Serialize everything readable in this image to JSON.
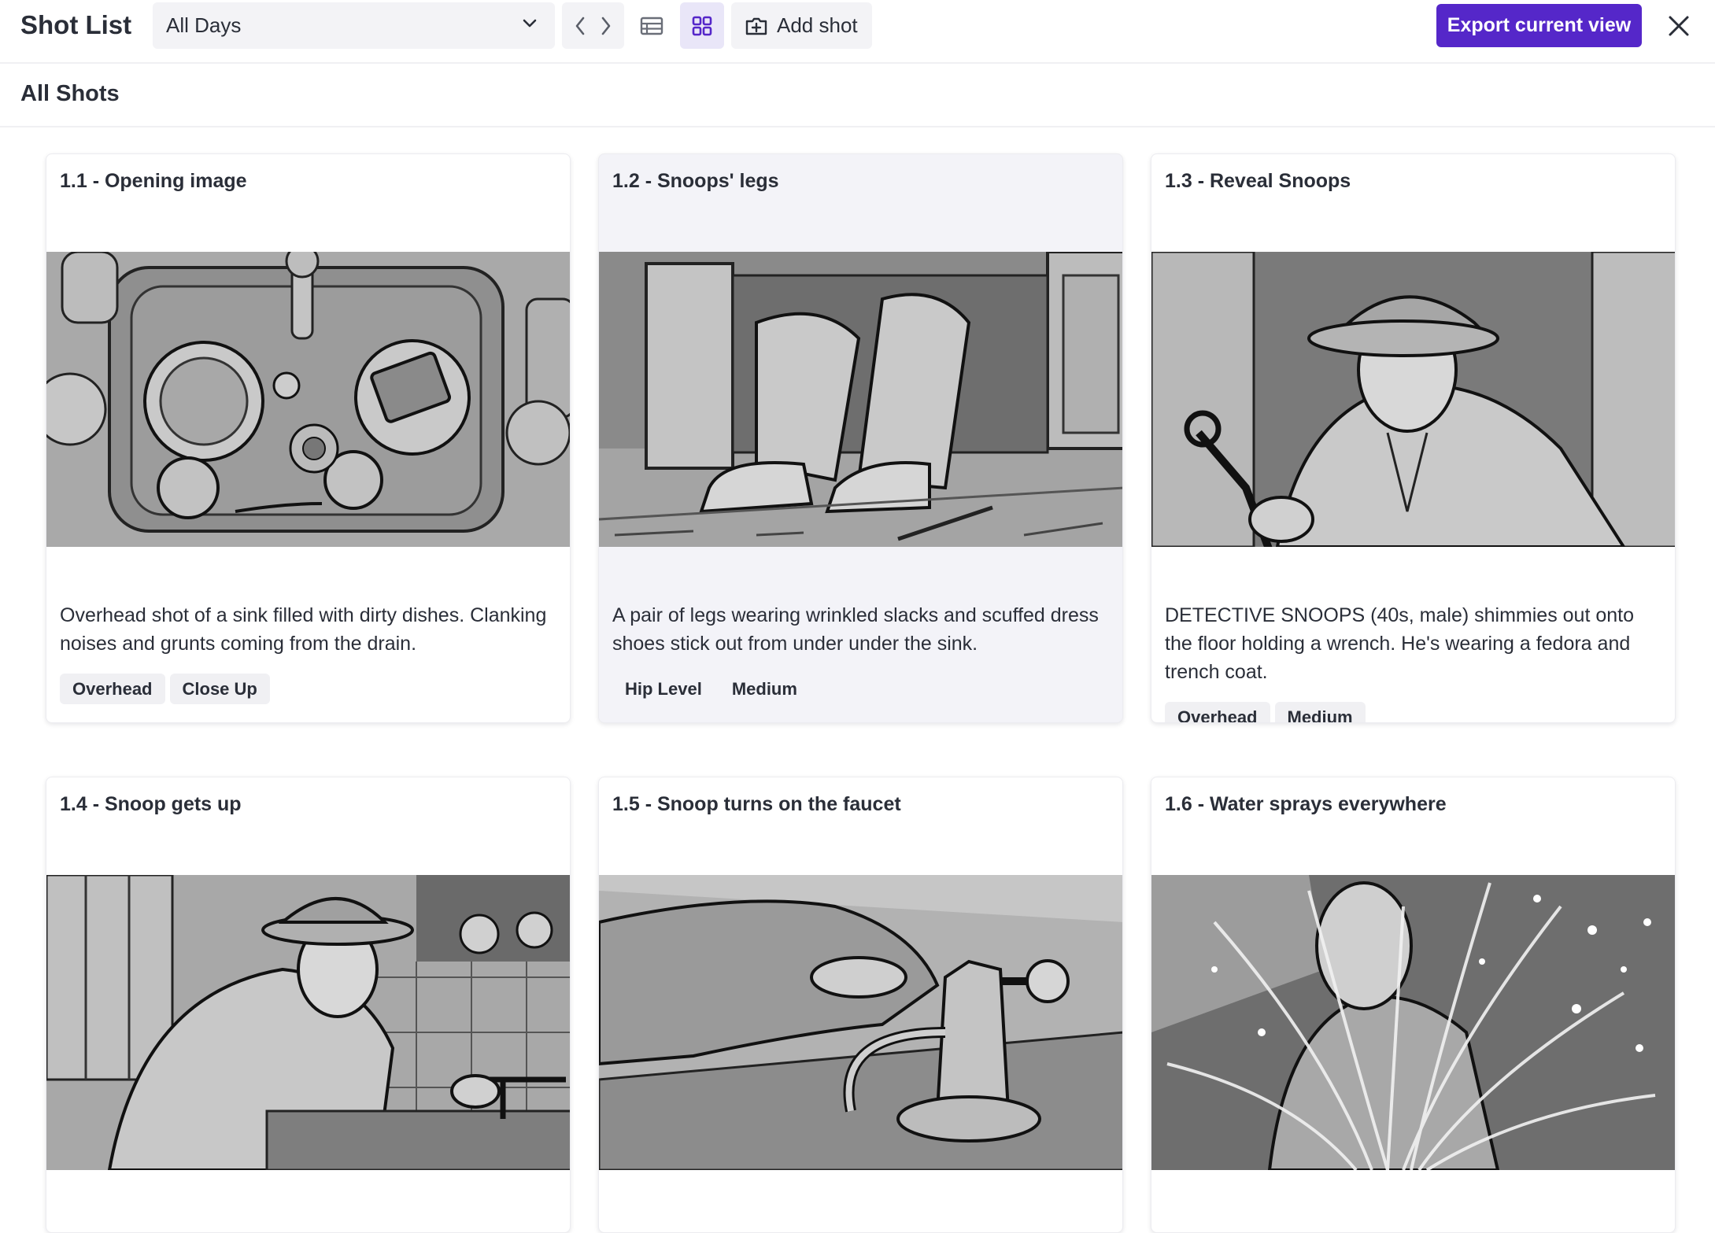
{
  "app": {
    "title": "Shot List"
  },
  "toolbar": {
    "day_select": {
      "value": "All Days"
    },
    "add_shot_label": "Add shot",
    "export_label": "Export current view",
    "active_view": "grid"
  },
  "section": {
    "title": "All Shots"
  },
  "colors": {
    "accent": "#5527c9",
    "active_view_bg": "#e9e6f8",
    "tag_bg": "#f0f0f3",
    "selected_card_bg": "#f3f3f8"
  },
  "shots": [
    {
      "title": "1.1 - Opening image",
      "description": "Overhead shot of a sink filled with dirty dishes. Clanking noises and grunts coming from the drain.",
      "tags": [
        "Overhead",
        "Close Up"
      ],
      "image": "sink-with-dishes-sketch",
      "selected": false
    },
    {
      "title": "1.2 - Snoops' legs",
      "description": "A pair of legs wearing wrinkled slacks and scuffed dress shoes stick out from under under the sink.",
      "tags": [
        "Hip Level",
        "Medium"
      ],
      "image": "legs-under-sink-sketch",
      "selected": true
    },
    {
      "title": "1.3 - Reveal Snoops",
      "description": "DETECTIVE SNOOPS (40s, male) shimmies out onto the floor holding a wrench. He's wearing a fedora and trench coat.",
      "tags": [
        "Overhead",
        "Medium"
      ],
      "image": "detective-with-wrench-sketch",
      "selected": false
    },
    {
      "title": "1.4 - Snoop gets up",
      "description": "",
      "tags": [],
      "image": "detective-at-sink-sketch",
      "selected": false
    },
    {
      "title": "1.5 - Snoop turns on the faucet",
      "description": "",
      "tags": [],
      "image": "hand-on-faucet-sketch",
      "selected": false
    },
    {
      "title": "1.6 - Water sprays everywhere",
      "description": "",
      "tags": [],
      "image": "water-spray-sketch",
      "selected": false
    }
  ]
}
